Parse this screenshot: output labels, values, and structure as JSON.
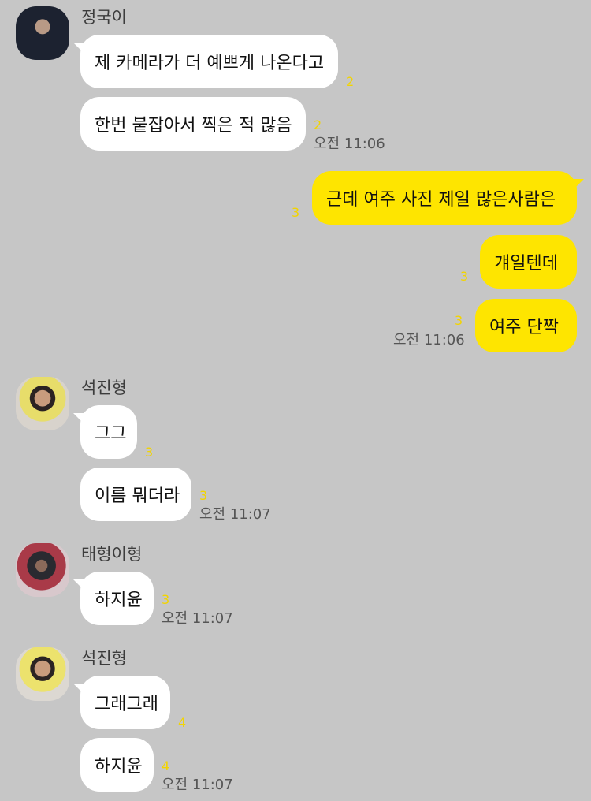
{
  "messages": {
    "g1": {
      "sender": "정국이",
      "m1": {
        "text": "제 카메라가 더 예쁘게 나온다고",
        "unread": "2"
      },
      "m2": {
        "text": "한번 붙잡아서 찍은 적 많음",
        "unread": "2"
      },
      "time": "오전 11:06"
    },
    "mine": {
      "m1": {
        "text": "근데 여주 사진 제일 많은사람은",
        "unread": "3"
      },
      "m2": {
        "text": "걔일텐데",
        "unread": "3"
      },
      "m3": {
        "text": "여주 단짝",
        "unread": "3"
      },
      "time": "오전 11:06"
    },
    "g2": {
      "sender": "석진형",
      "m1": {
        "text": "그그",
        "unread": "3"
      },
      "m2": {
        "text": "이름 뭐더라",
        "unread": "3"
      },
      "time": "오전 11:07"
    },
    "g3": {
      "sender": "태형이형",
      "m1": {
        "text": "하지윤",
        "unread": "3"
      },
      "time": "오전 11:07"
    },
    "g4": {
      "sender": "석진형",
      "m1": {
        "text": "그래그래",
        "unread": "4"
      },
      "m2": {
        "text": "하지윤",
        "unread": "4"
      },
      "time": "오전 11:07"
    }
  }
}
